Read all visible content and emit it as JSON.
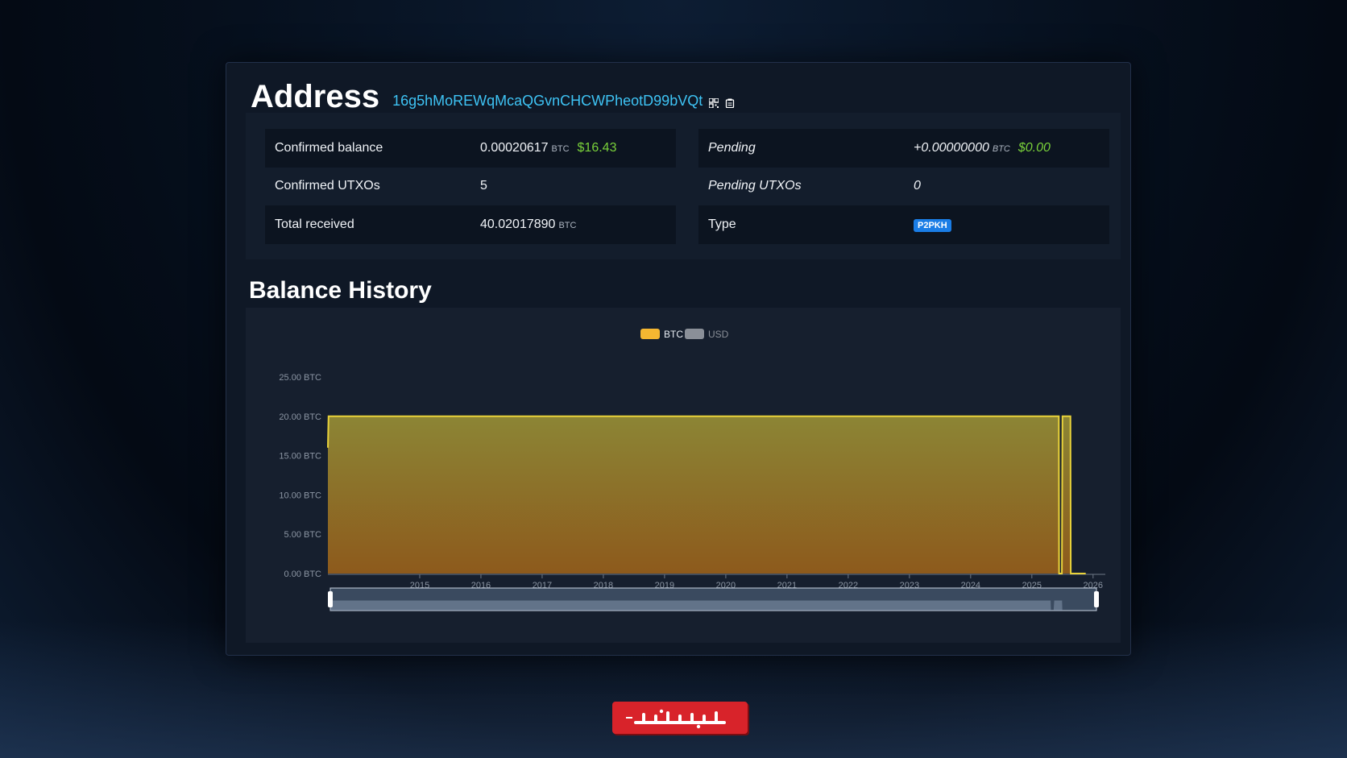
{
  "header": {
    "title": "Address",
    "address": "16g5hMoREWqMcaQGvnCHCWPheotD99bVQt"
  },
  "info": {
    "left": [
      {
        "label": "Confirmed balance",
        "value": "0.00020617",
        "unit": "BTC",
        "usd": "$16.43"
      },
      {
        "label": "Confirmed UTXOs",
        "value": "5"
      },
      {
        "label": "Total received",
        "value": "40.02017890",
        "unit": "BTC"
      }
    ],
    "right": [
      {
        "label": "Pending",
        "value": "+0.00000000",
        "unit": "BTC",
        "usd": "$0.00"
      },
      {
        "label": "Pending UTXOs",
        "value": "0"
      },
      {
        "label": "Type",
        "badge": "P2PKH"
      }
    ]
  },
  "section": {
    "balance_history": "Balance History"
  },
  "colors": {
    "accent": "#3ec3f4",
    "usd": "#7ad23a",
    "badge": "#1a7de6",
    "btc_series": "#f5b731",
    "usd_series": "#8a8f98"
  },
  "chart_data": {
    "type": "area",
    "legend": [
      {
        "name": "BTC",
        "color": "#f5b731",
        "active": true
      },
      {
        "name": "USD",
        "color": "#8a8f98",
        "active": false
      }
    ],
    "legend_position": "top-center",
    "y_ticks": [
      "0.00 BTC",
      "5.00 BTC",
      "10.00 BTC",
      "15.00 BTC",
      "20.00 BTC",
      "25.00 BTC"
    ],
    "ylim": [
      0,
      25
    ],
    "x_ticks": [
      "2015",
      "2016",
      "2017",
      "2018",
      "2019",
      "2020",
      "2021",
      "2022",
      "2023",
      "2024",
      "2025",
      "2026"
    ],
    "xlim": [
      2014.0,
      2026.7
    ],
    "series": [
      {
        "name": "BTC",
        "points": [
          [
            2014.0,
            16.0
          ],
          [
            2014.01,
            20.0
          ],
          [
            2025.94,
            20.0
          ],
          [
            2025.945,
            0.0
          ],
          [
            2025.99,
            0.0
          ],
          [
            2026.0,
            20.0
          ],
          [
            2026.13,
            20.0
          ],
          [
            2026.135,
            0.0002
          ],
          [
            2026.38,
            0.0002
          ]
        ]
      }
    ],
    "grid": false
  }
}
